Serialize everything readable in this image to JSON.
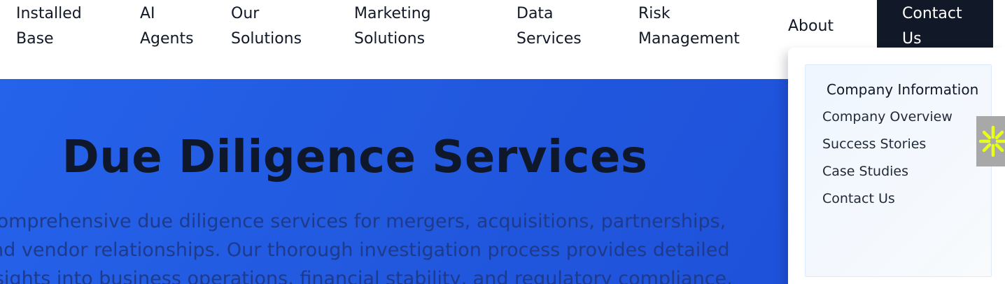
{
  "nav": {
    "items": [
      {
        "label": "Installed\nBase"
      },
      {
        "label": "AI\nAgents"
      },
      {
        "label": "Our\nSolutions"
      },
      {
        "label": "Marketing\nSolutions"
      },
      {
        "label": "Data\nServices"
      },
      {
        "label": "Risk\nManagement"
      },
      {
        "label": "About"
      }
    ],
    "cta_label": "Contact\nUs"
  },
  "hero": {
    "title": "Due Diligence Services",
    "description": "Comprehensive due diligence services for mergers, acquisitions, partnerships, and vendor relationships. Our thorough investigation process provides detailed insights into business operations, financial stability, and regulatory compliance."
  },
  "dropdown": {
    "heading": "Company Information",
    "links": [
      {
        "label": "Company Overview"
      },
      {
        "label": "Success Stories"
      },
      {
        "label": "Case Studies"
      },
      {
        "label": "Contact Us"
      }
    ]
  },
  "widget": {
    "icon": "sparkle-icon",
    "color": "#e8ff1a"
  },
  "colors": {
    "hero_bg": "#2563eb",
    "cta_bg": "#111827",
    "title": "#0f172a"
  }
}
